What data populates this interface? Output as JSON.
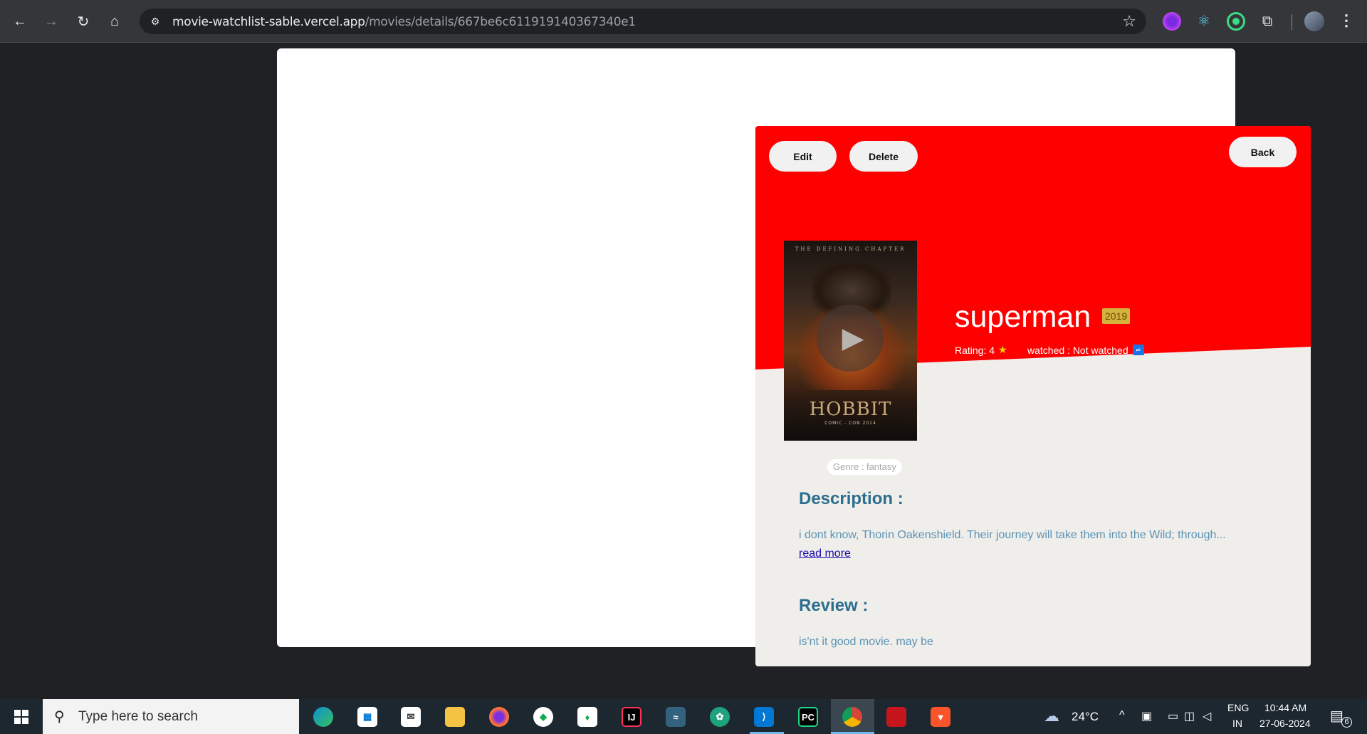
{
  "browser": {
    "url_host": "movie-watchlist-sable.vercel.app",
    "url_path": "/movies/details/667be6c611919140367340e1"
  },
  "page": {
    "buttons": {
      "edit": "Edit",
      "delete": "Delete",
      "back": "Back"
    },
    "movie": {
      "title": "superman",
      "year": "2019",
      "rating_label": "Rating: 4",
      "rating_value": 4,
      "watched_label": "watched : Not watched",
      "genre_label": "Genre : fantasy",
      "poster": {
        "tagline": "THE DEFINING CHAPTER",
        "title": "HOBBIT",
        "subtitle": "COMIC - CON 2014"
      }
    },
    "description": {
      "heading": "Description :",
      "text": "i dont know, Thorin Oakenshield. Their journey will take them into the Wild; through...",
      "read_more": "read more"
    },
    "review": {
      "heading": "Review :",
      "text": "is'nt it good movie. may be"
    },
    "colors": {
      "hero": "#ff0000",
      "card": "#efeeeb",
      "heading": "#2c6e8e",
      "body_text": "#5b93b4"
    }
  },
  "taskbar": {
    "search_placeholder": "Type here to search",
    "weather": "24°C",
    "lang_top": "ENG",
    "lang_bottom": "IN",
    "time": "10:44 AM",
    "date": "27-06-2024",
    "notifications": "6"
  }
}
